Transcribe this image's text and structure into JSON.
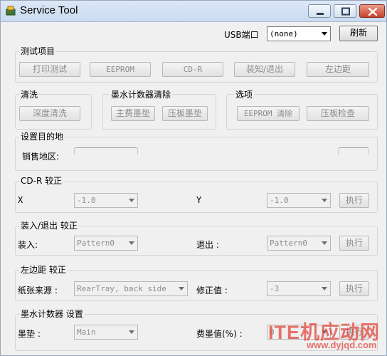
{
  "window": {
    "title": "Service Tool",
    "colors": {
      "titlebar": "#c9dbf0",
      "close_button": "#c8412b",
      "face": "#f0f0f0"
    }
  },
  "usb": {
    "label": "USB端口",
    "selected": "(none)",
    "refresh_label": "刷新"
  },
  "test_items": {
    "title": "测试项目",
    "buttons": [
      "打印测试",
      "EEPROM",
      "CD-R",
      "装知/退出",
      "左边距"
    ]
  },
  "cleaning": {
    "title": "清洗",
    "button": "深度清洗"
  },
  "ink_counter_clear": {
    "title": "墨水计数器清除",
    "buttons": [
      "主费墨垫",
      "压板墨垫"
    ]
  },
  "options": {
    "title": "选项",
    "buttons": [
      "EEPROM 清除",
      "压板检查"
    ]
  },
  "destination": {
    "title": "设置目的地",
    "region_label": "销售地区:"
  },
  "cdr_calibration": {
    "title": "CD-R 较正",
    "x_label": "X",
    "x_value": "-1.0",
    "y_label": "Y",
    "y_value": "-1.0",
    "run_label": "执行"
  },
  "load_eject_calibration": {
    "title": "装入/退出 较正",
    "load_label": "装入:",
    "load_value": "Pattern0",
    "eject_label": "退出 :",
    "eject_value": "Pattern0",
    "run_label": "执行"
  },
  "left_margin_calibration": {
    "title": "左边距 较正",
    "source_label": "纸张来源 :",
    "source_value": "RearTray, back side",
    "correction_label": "修正值 :",
    "correction_value": "-3",
    "run_label": "执行"
  },
  "ink_counter_settings": {
    "title": "墨水计数器 设置",
    "pad_label": "墨垫 :",
    "pad_value": "Main",
    "waste_label": "费墨值(%) :",
    "waste_value": "0",
    "run_label": "执行"
  },
  "watermark": {
    "text": "ITE机应动网",
    "url": "www.dyjqd.com"
  }
}
